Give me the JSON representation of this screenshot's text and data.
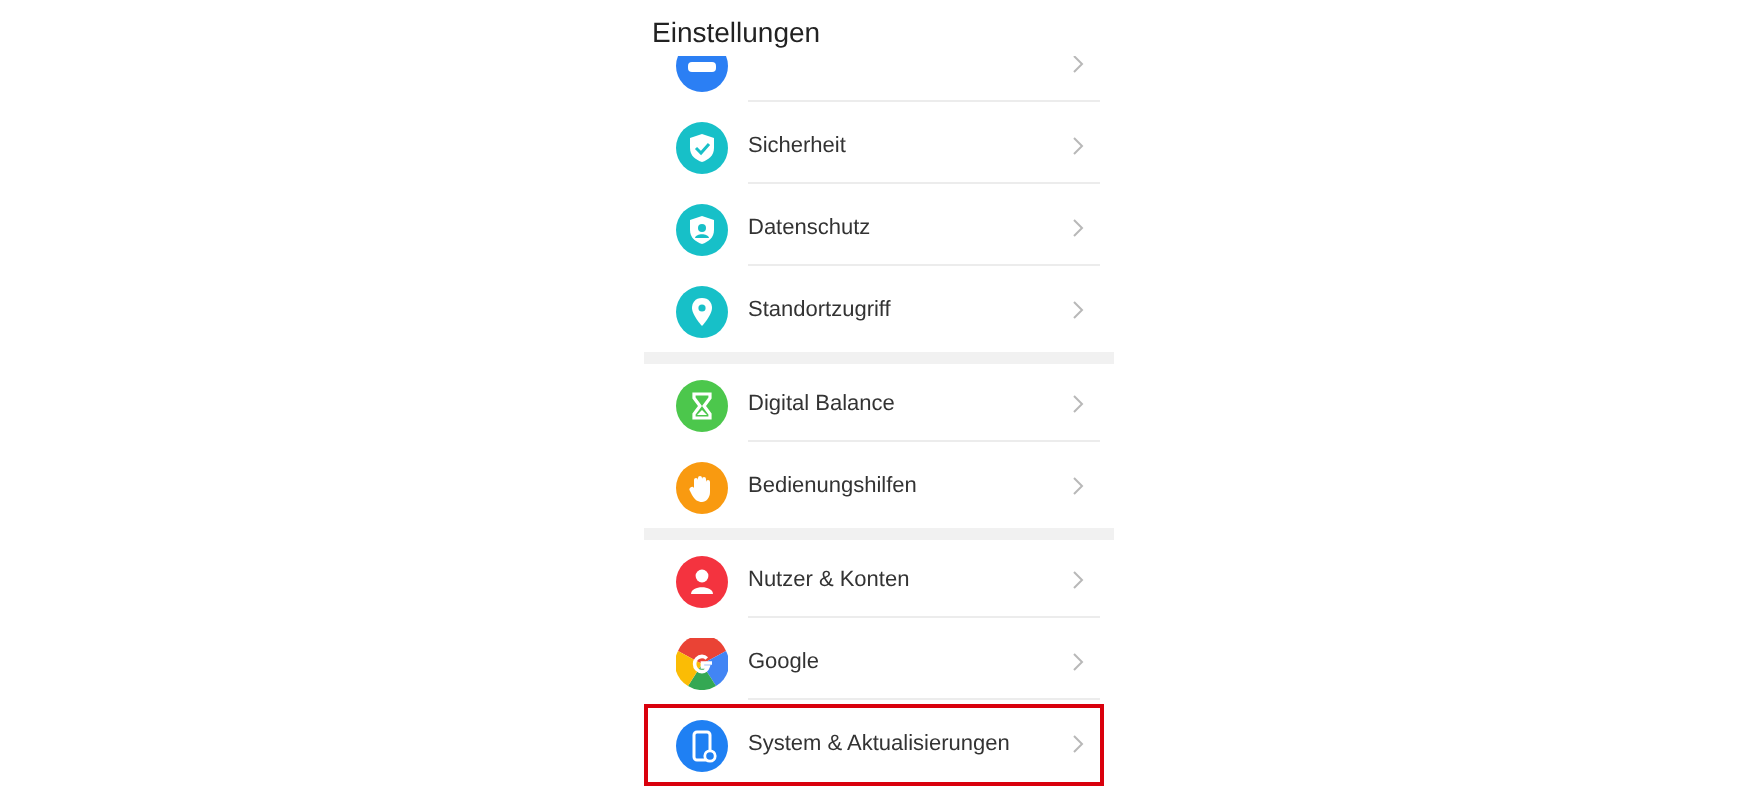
{
  "header": {
    "title": "Einstellungen"
  },
  "groups": [
    {
      "items": [
        {
          "kind": "storage",
          "color": "#2b7ff4",
          "selected": false
        },
        {
          "label": "Sicherheit",
          "kind": "shield-check",
          "color": "#17c0c8",
          "selected": false
        },
        {
          "label": "Datenschutz",
          "kind": "shield-person",
          "color": "#17c0c8",
          "selected": false
        },
        {
          "label": "Standortzugriff",
          "kind": "pin",
          "color": "#17c0c8",
          "selected": false
        }
      ]
    },
    {
      "items": [
        {
          "label": "Digital Balance",
          "kind": "hourglass",
          "color": "#4cc74c",
          "selected": false
        },
        {
          "label": "Bedienungshilfen",
          "kind": "hand",
          "color": "#f99a10",
          "selected": false
        }
      ]
    },
    {
      "items": [
        {
          "label": "Nutzer & Konten",
          "kind": "person",
          "color": "#f4333f",
          "selected": false
        },
        {
          "label": "Google",
          "kind": "google",
          "selected": false
        },
        {
          "label": "System & Aktualisierungen",
          "kind": "phone-gear",
          "color": "#1f80f3",
          "selected": true
        }
      ]
    }
  ]
}
